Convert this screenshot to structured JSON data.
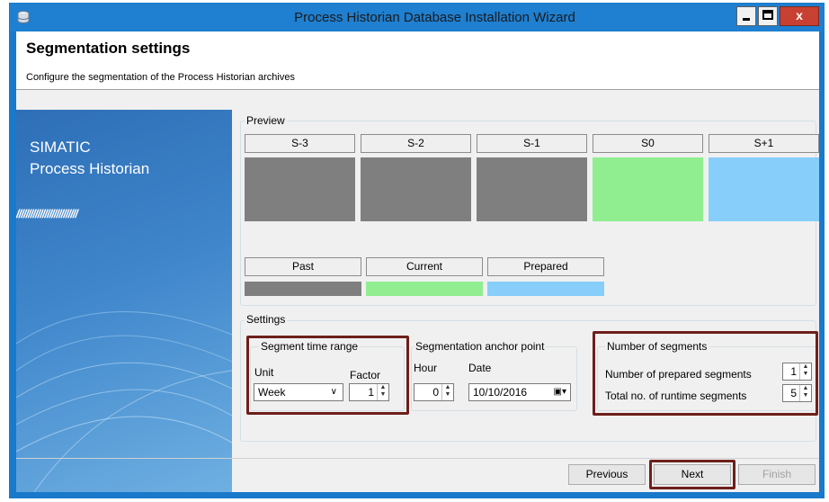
{
  "window": {
    "title": "Process Historian Database Installation Wizard",
    "close_glyph": "x"
  },
  "header": {
    "title": "Segmentation settings",
    "subtitle": "Configure the segmentation of the Process Historian archives"
  },
  "brand": {
    "line1": "SIMATIC",
    "line2": "Process Historian",
    "stripes": "//////////////////////////"
  },
  "preview": {
    "label": "Preview",
    "segments": [
      {
        "label": "S-3",
        "color": "#7f7f7f"
      },
      {
        "label": "S-2",
        "color": "#7f7f7f"
      },
      {
        "label": "S-1",
        "color": "#7f7f7f"
      },
      {
        "label": "S0",
        "color": "#90ee90"
      },
      {
        "label": "S+1",
        "color": "#87cefa"
      }
    ],
    "legend": [
      {
        "label": "Past",
        "color": "#7f7f7f"
      },
      {
        "label": "Current",
        "color": "#90ee90"
      },
      {
        "label": "Prepared",
        "color": "#87cefa"
      }
    ]
  },
  "settings": {
    "label": "Settings",
    "time_range": {
      "label": "Segment time range",
      "unit_label": "Unit",
      "unit_value": "Week",
      "factor_label": "Factor",
      "factor_value": "1"
    },
    "anchor": {
      "label": "Segmentation anchor point",
      "hour_label": "Hour",
      "hour_value": "0",
      "date_label": "Date",
      "date_value": "10/10/2016"
    },
    "segments": {
      "label": "Number of segments",
      "prepared_label": "Number of prepared segments",
      "prepared_value": "1",
      "runtime_label": "Total no. of runtime segments",
      "runtime_value": "5"
    }
  },
  "buttons": {
    "previous": "Previous",
    "next": "Next",
    "finish": "Finish"
  },
  "colors": {
    "highlight": "#6e1f1a",
    "titlebar": "#1f7fd0"
  }
}
